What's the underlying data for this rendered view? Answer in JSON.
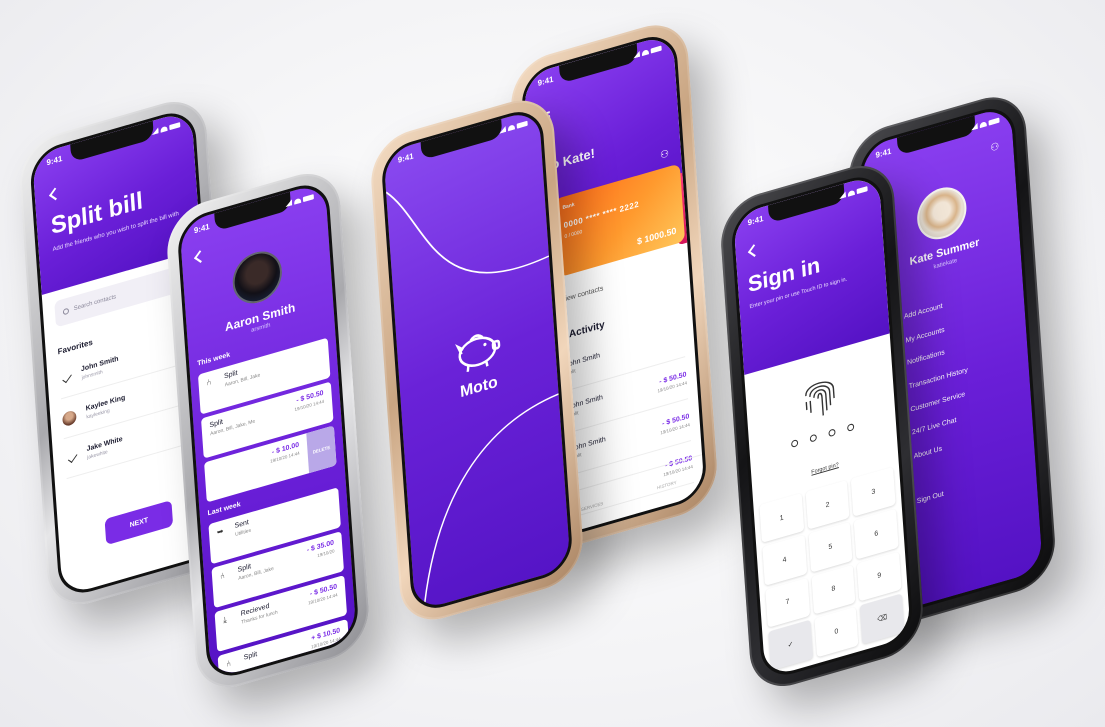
{
  "status_time": "9:41",
  "colors": {
    "purple": "#7a2ce6",
    "orange_card": "#ff9a2e",
    "pink_card": "#e81e63"
  },
  "split_bill": {
    "title": "Split bill",
    "subtitle": "Add the friends who you wish to split the bill with",
    "search_placeholder": "Search contacts",
    "favorites_label": "Favorites",
    "contacts": [
      {
        "name": "John Smith",
        "username": "johnsmith",
        "checked": true
      },
      {
        "name": "Kaylee King",
        "username": "kayleeking",
        "checked": false
      },
      {
        "name": "Jake White",
        "username": "jakewhite",
        "checked": true
      }
    ],
    "next_label": "NEXT"
  },
  "profile_aaron": {
    "name": "Aaron Smith",
    "handle": "arsmith",
    "this_week_label": "This week",
    "last_week_label": "Last week",
    "delete_label": "DELETE",
    "tx_this_week": [
      {
        "icon": "split-icon",
        "glyph": "⑃",
        "title": "Split",
        "sub": "Aaron, Bill, Jake",
        "amount": "",
        "date": ""
      },
      {
        "icon": "",
        "glyph": "",
        "title": "Split",
        "sub": "Aaron, Bill, Jake, Me",
        "amount": "- $ 50.50",
        "date": "19/10/20 14:44"
      },
      {
        "icon": "",
        "glyph": "",
        "title": "",
        "sub": "",
        "amount": "- $ 10.00",
        "date": "19/10/20 14:44"
      }
    ],
    "tx_last_week": [
      {
        "icon": "sent-icon",
        "glyph": "➥",
        "title": "Sent",
        "sub": "Utilities",
        "amount": "",
        "date": ""
      },
      {
        "icon": "split-icon",
        "glyph": "⑃",
        "title": "Split",
        "sub": "Aaron, Bill, Jake",
        "amount": "- $ 35.00",
        "date": "19/10/20"
      },
      {
        "icon": "received-icon",
        "glyph": "⤓",
        "title": "Recieved",
        "sub": "Thanks for lunch",
        "amount": "- $ 50.50",
        "date": "19/10/20 14:44"
      },
      {
        "icon": "split-icon",
        "glyph": "⑃",
        "title": "Split",
        "sub": "",
        "amount": "+ $ 10.50",
        "date": "19/10/20 14:44"
      }
    ]
  },
  "splash": {
    "brand": "Moto",
    "logo_icon": "piggy-bank-icon"
  },
  "home": {
    "greeting": "o Kate!",
    "card_brand": "Bank",
    "card_number": "0000 **** **** 2222",
    "card_expiry": "0 / 0000",
    "card_balance": "$ 1000.50",
    "view_contacts": "View contacts",
    "recent_activity": "t Activity",
    "activity": [
      {
        "name": "John Smith",
        "type": "Split",
        "amount": "",
        "date": ""
      },
      {
        "name": "John Smith",
        "type": "Split",
        "amount": "- $ 50.50",
        "date": "19/10/20 14:44"
      },
      {
        "name": "John Smith",
        "type": "Split",
        "amount": "- $ 50.50",
        "date": "19/10/20 14:44"
      },
      {
        "name": "",
        "type": "",
        "amount": "- $ 50.50",
        "date": "19/10/20 14:44"
      }
    ],
    "tabs": [
      "SERVICES",
      "HISTORY"
    ]
  },
  "signin": {
    "title": "Sign in",
    "subtitle": "Enter your pin or use Touch ID to sign in.",
    "forgot": "Forgot pin?",
    "keys": [
      "1",
      "2",
      "3",
      "4",
      "5",
      "6",
      "7",
      "8",
      "9",
      "✓",
      "0",
      "⌫"
    ]
  },
  "profile_kate": {
    "name": "Kate Summer",
    "handle": "katiekate",
    "menu": [
      {
        "label": "Add Account",
        "icon": "add-icon",
        "glyph": "+"
      },
      {
        "label": "My Accounts",
        "icon": "accounts-icon",
        "glyph": "▣"
      },
      {
        "label": "Notifications",
        "icon": "bell-icon",
        "glyph": "◔"
      },
      {
        "label": "Transaction History",
        "icon": "history-icon",
        "glyph": "↺"
      },
      {
        "label": "Customer Service",
        "icon": "service-icon",
        "glyph": "✉"
      },
      {
        "label": "24/7 Live Chat",
        "icon": "chat-icon",
        "glyph": "☏"
      },
      {
        "label": "About Us",
        "icon": "info-icon",
        "glyph": "ⓘ"
      }
    ],
    "sign_out": "Sign Out"
  }
}
